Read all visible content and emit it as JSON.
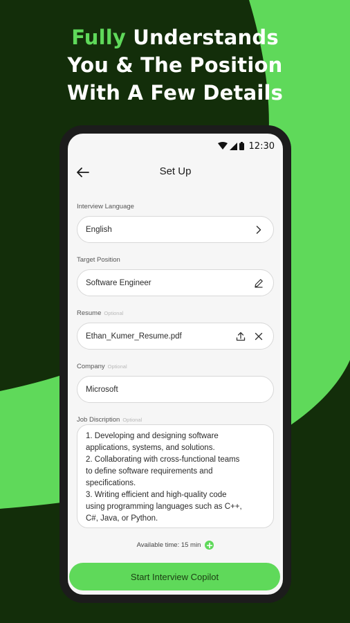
{
  "headline": {
    "accent": "Fully",
    "line1_rest": " Understands",
    "line2": "You & The Position",
    "line3": "With A Few Details"
  },
  "status_bar": {
    "time": "12:30"
  },
  "topbar": {
    "title": "Set Up"
  },
  "form": {
    "language": {
      "label": "Interview Language",
      "value": "English"
    },
    "position": {
      "label": "Target Position",
      "value": "Software Engineer"
    },
    "resume": {
      "label": "Resume",
      "optional": "Optional",
      "value": "Ethan_Kumer_Resume.pdf"
    },
    "company": {
      "label": "Company",
      "optional": "Optional",
      "value": "Microsoft"
    },
    "job": {
      "label": "Job Discription",
      "optional": "Optional",
      "lines": [
        "1. Developing and designing software",
        "applications, systems, and solutions.",
        "2. Collaborating with cross-functional teams",
        "to define software requirements and",
        "specifications.",
        "3. Writing efficient and high-quality code",
        "using programming languages such as C++,",
        "C#, Java, or Python."
      ]
    }
  },
  "available_time": "Available time: 15 min",
  "cta_label": "Start Interview Copilot",
  "colors": {
    "accent": "#5fd95a",
    "background": "#132e0a",
    "screen": "#f6f6f6"
  }
}
